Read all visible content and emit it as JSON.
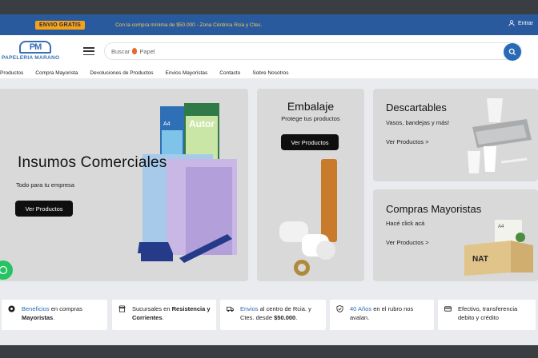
{
  "promo": {
    "badge": "ENVIO GRATIS",
    "message": "Con la compra mínima de $50.000 - Zona Céntrica Rcia y Ctes.",
    "login": "Entrar",
    "colors": {
      "bar": "#2a5a9e",
      "badge": "#f6a218",
      "message": "#f2c95a"
    }
  },
  "header": {
    "logo_mark": "PM",
    "logo_name": "PAPELERIA MARANO",
    "search_placeholder_prefix": "Buscar",
    "search_placeholder_term": "Papel",
    "search_icon": "search-icon",
    "menu_icon": "hamburger-menu-icon"
  },
  "nav": {
    "items": [
      "Productos",
      "Compra Mayorista",
      "Devoluciones de Productos",
      "Envios Mayoristas",
      "Contacto",
      "Sobre Nosotros"
    ]
  },
  "cards": {
    "insumos": {
      "title": "Insumos Comerciales",
      "subtitle": "Todo para tu empresa",
      "button": "Ver Productos",
      "box_label": "Autor",
      "box_size": "A4"
    },
    "embalaje": {
      "title": "Embalaje",
      "subtitle": "Protege tus productos",
      "button": "Ver Productos"
    },
    "descartables": {
      "title": "Descartables",
      "subtitle": "Vasos, bandejas y más!",
      "link": "Ver Productos >"
    },
    "mayoristas": {
      "title": "Compras Mayoristas",
      "subtitle": "Hacé click acá",
      "link": "Ver Productos >",
      "box_label": "NAT",
      "box_size": "A4"
    }
  },
  "features": [
    {
      "icon": "badge-icon",
      "highlight": "Beneficios",
      "text": " en compras ",
      "bold": "Mayoristas",
      "tail": "."
    },
    {
      "icon": "store-icon",
      "highlight": "",
      "text": "Sucursales en ",
      "bold": "Resistencia y Corrientes",
      "tail": "."
    },
    {
      "icon": "truck-icon",
      "highlight": "Envios",
      "text": " al centro de Rcia. y Ctes. desde ",
      "bold": "$50.000",
      "tail": "."
    },
    {
      "icon": "shield-check-icon",
      "highlight": "40 Años",
      "text": " en el rubro nos avalan.",
      "bold": "",
      "tail": ""
    },
    {
      "icon": "credit-card-icon",
      "highlight": "",
      "text": "Efectivo, transferencia debito y crédito",
      "bold": "",
      "tail": ""
    }
  ],
  "whatsapp_icon": "whatsapp-icon"
}
